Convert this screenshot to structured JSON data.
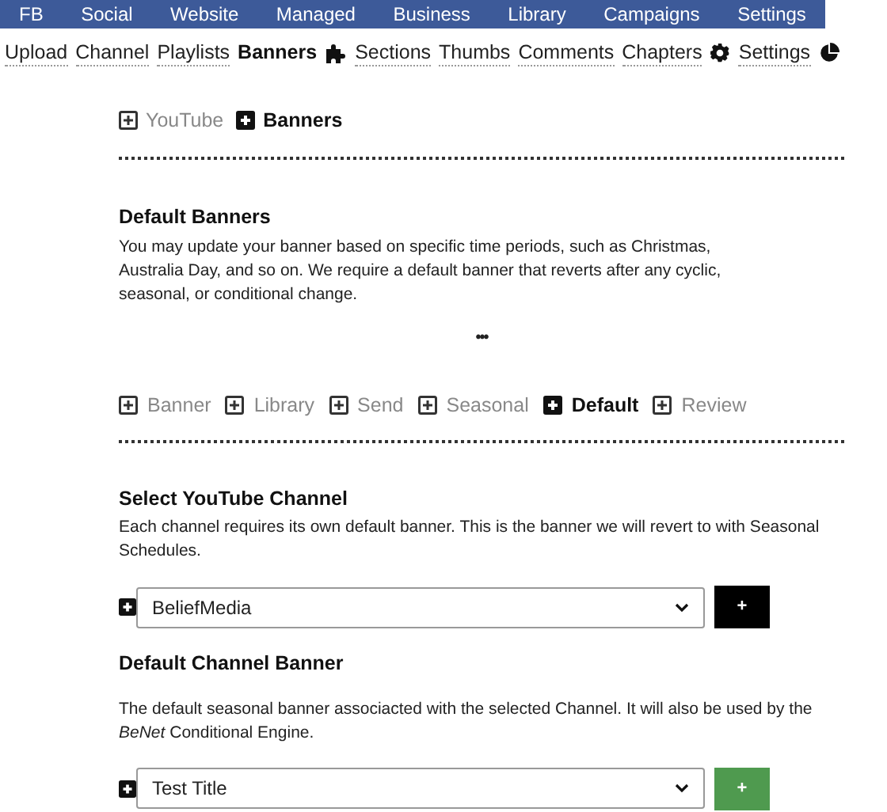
{
  "top_nav": [
    {
      "label": "FB"
    },
    {
      "label": "Social"
    },
    {
      "label": "Website"
    },
    {
      "label": "Managed"
    },
    {
      "label": "Business"
    },
    {
      "label": "Library"
    },
    {
      "label": "Campaigns"
    },
    {
      "label": "Settings"
    }
  ],
  "sub_nav": [
    {
      "kind": "link",
      "label": "Upload",
      "selected": false
    },
    {
      "kind": "link",
      "label": "Channel",
      "selected": false
    },
    {
      "kind": "link",
      "label": "Playlists",
      "selected": false
    },
    {
      "kind": "link",
      "label": "Banners",
      "selected": true
    },
    {
      "kind": "puzzle"
    },
    {
      "kind": "link",
      "label": "Sections",
      "selected": false
    },
    {
      "kind": "link",
      "label": "Thumbs",
      "selected": false
    },
    {
      "kind": "link",
      "label": "Comments",
      "selected": false
    },
    {
      "kind": "link",
      "label": "Chapters",
      "selected": false
    },
    {
      "kind": "gear"
    },
    {
      "kind": "link",
      "label": "Settings",
      "selected": false
    },
    {
      "kind": "pie"
    }
  ],
  "breadcrumb": [
    {
      "label": "YouTube",
      "selected": false
    },
    {
      "label": "Banners",
      "selected": true
    }
  ],
  "intro": {
    "title": "Default Banners",
    "text": "You may update your banner based on specific time periods, such as Christmas, Australia Day, and so on. We require a default banner that reverts after any cyclic, seasonal, or conditional change.",
    "more": "•••"
  },
  "tabs": [
    {
      "label": "Banner",
      "selected": false
    },
    {
      "label": "Library",
      "selected": false
    },
    {
      "label": "Send",
      "selected": false
    },
    {
      "label": "Seasonal",
      "selected": false
    },
    {
      "label": "Default",
      "selected": true
    },
    {
      "label": "Review",
      "selected": false
    }
  ],
  "sections": [
    {
      "title": "Select YouTube Channel",
      "text": "Each channel requires its own default banner. This is the banner we will revert to with Seasonal Schedules.",
      "select": "BeliefMedia",
      "button": {
        "label": "+",
        "kind": "dark"
      }
    },
    {
      "title": "Default Channel Banner",
      "text": "The default seasonal banner associacted with the selected Channel. It will also be used by the *BeNet* Conditional Engine.",
      "select": "Test Title",
      "button": {
        "label": "+",
        "kind": "success"
      }
    }
  ]
}
